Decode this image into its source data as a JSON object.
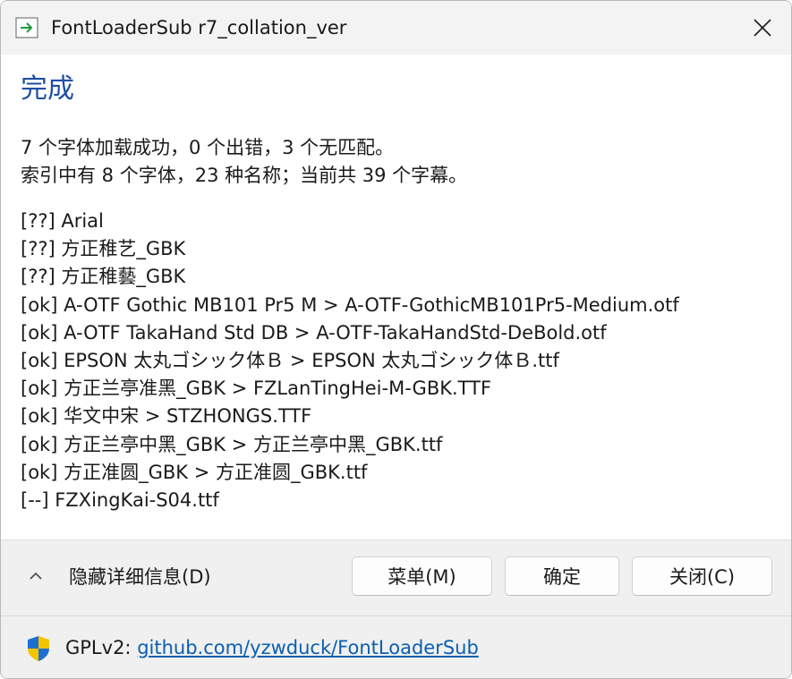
{
  "window": {
    "title": "FontLoaderSub r7_collation_ver",
    "app_icon": "arrow-right-icon",
    "close_icon": "close-icon"
  },
  "main": {
    "heading": "完成",
    "summary": [
      "7 个字体加载成功，0 个出错，3 个无匹配。",
      "索引中有 8 个字体，23 种名称；当前共 39 个字幕。"
    ],
    "log": [
      "[??] Arial",
      "[??] 方正稚艺_GBK",
      "[??] 方正稚藝_GBK",
      "[ok] A-OTF Gothic MB101 Pr5 M > A-OTF-GothicMB101Pr5-Medium.otf",
      "[ok] A-OTF TakaHand Std DB > A-OTF-TakaHandStd-DeBold.otf",
      "[ok] EPSON 太丸ゴシック体Ｂ > EPSON 太丸ゴシック体Ｂ.ttf",
      "[ok] 方正兰亭准黑_GBK > FZLanTingHei-M-GBK.TTF",
      "[ok] 华文中宋 > STZHONGS.TTF",
      "[ok] 方正兰亭中黑_GBK > 方正兰亭中黑_GBK.ttf",
      "[ok] 方正准圆_GBK > 方正准圆_GBK.ttf",
      "[--] FZXingKai-S04.ttf"
    ]
  },
  "buttons": {
    "details_toggle": "隐藏详细信息(D)",
    "menu": "菜单(M)",
    "ok": "确定",
    "close": "关闭(C)"
  },
  "footer": {
    "license": "GPLv2:",
    "link": "github.com/yzwduck/FontLoaderSub",
    "icon": "shield-icon"
  },
  "colors": {
    "heading": "#1e4fa3",
    "link": "#0a5fb0",
    "titlebar_bg": "#f3f3f3",
    "footer_bg": "#f0f0f0"
  }
}
